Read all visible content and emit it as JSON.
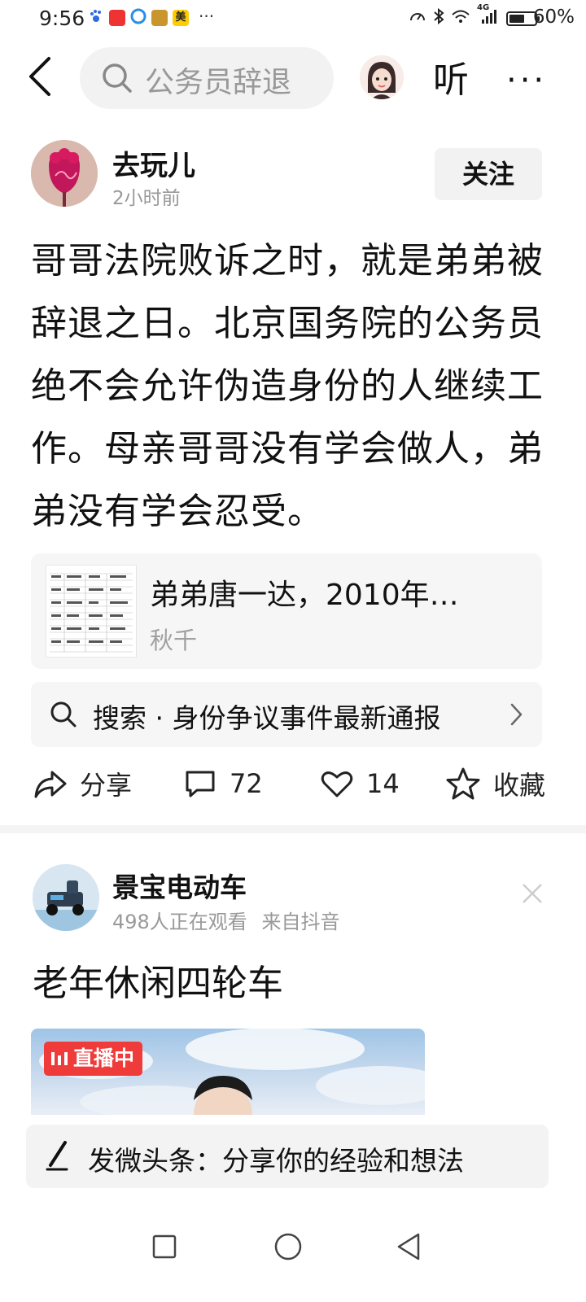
{
  "status_bar": {
    "time": "9:56",
    "app_icons": [
      "paw-icon",
      "app-red-icon",
      "browser-icon",
      "app-gold-icon",
      "meituan-icon"
    ],
    "meituan_label": "美",
    "more_dots": "···",
    "network_label": "4G",
    "battery_percent": "60%",
    "battery_level": 0.6
  },
  "top_bar": {
    "search_text": "公务员辞退",
    "listen_label": "听",
    "more_label": "···"
  },
  "post": {
    "author": "去玩儿",
    "time": "2小时前",
    "follow_label": "关注",
    "content": "哥哥法院败诉之时，就是弟弟被辞退之日。北京国务院的公务员绝不会允许伪造身份的人继续工作。母亲哥哥没有学会做人，弟弟没有学会忍受。",
    "quote_card": {
      "title": "弟弟唐一达，2010年…",
      "source": "秋千"
    },
    "search_suggestion": {
      "text": "搜索 · 身份争议事件最新通报"
    },
    "actions": {
      "share_label": "分享",
      "comment_count": "72",
      "like_count": "14",
      "favorite_label": "收藏"
    }
  },
  "second_post": {
    "author": "景宝电动车",
    "watching": "498人正在观看",
    "source": "来自抖音",
    "title": "老年休闲四轮车",
    "live_badge": "直播中"
  },
  "compose_bar": {
    "text": "发微头条：分享你的经验和想法"
  },
  "colors": {
    "accent_red": "#f03b3b",
    "text_primary": "#111111",
    "text_secondary": "#999999",
    "card_bg": "#f6f6f7"
  }
}
